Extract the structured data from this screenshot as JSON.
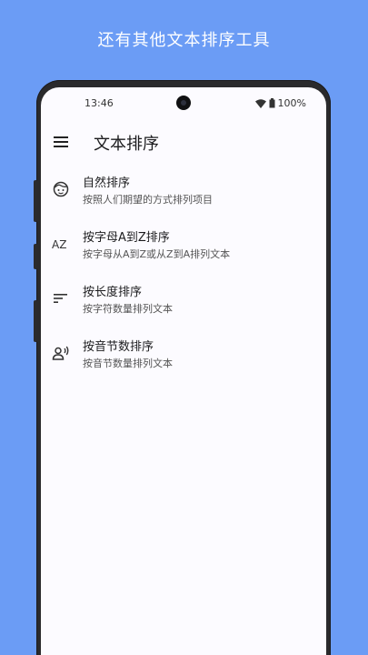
{
  "promo": {
    "title": "还有其他文本排序工具"
  },
  "status_bar": {
    "time": "13:46",
    "battery": "100%"
  },
  "app_bar": {
    "title": "文本排序",
    "menu_icon": "menu-icon"
  },
  "items": [
    {
      "icon": "smile-face-icon",
      "title": "自然排序",
      "subtitle": "按照人们期望的方式排列项目"
    },
    {
      "icon": "az-sort-icon",
      "icon_text": "AZ",
      "title": "按字母A到Z排序",
      "subtitle": "按字母从A到Z或从Z到A排列文本"
    },
    {
      "icon": "length-sort-icon",
      "title": "按长度排序",
      "subtitle": "按字符数量排列文本"
    },
    {
      "icon": "voice-person-icon",
      "title": "按音节数排序",
      "subtitle": "按音节数量排列文本"
    }
  ],
  "colors": {
    "background": "#6b9cf5",
    "screen": "#fcfbff",
    "frame": "#2a2a2c"
  }
}
